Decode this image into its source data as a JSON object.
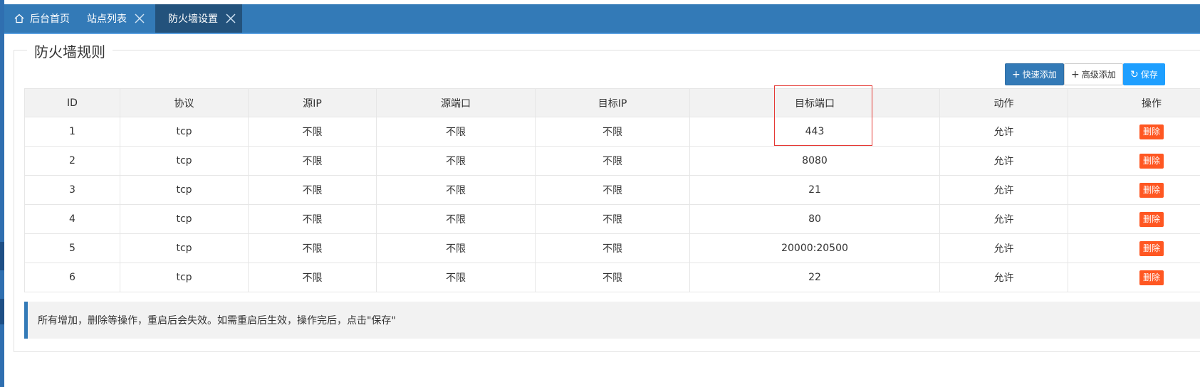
{
  "tabs": [
    {
      "label": "后台首页",
      "icon": "home-icon",
      "closable": false,
      "active": false
    },
    {
      "label": "站点列表",
      "icon": null,
      "closable": true,
      "active": false
    },
    {
      "label": "防火墙设置",
      "icon": null,
      "closable": true,
      "active": true
    }
  ],
  "panel": {
    "title": "防火墙规则"
  },
  "toolbar": {
    "quick_add": "快速添加",
    "advanced_add": "高级添加",
    "save": "保存"
  },
  "table": {
    "columns": [
      "ID",
      "协议",
      "源IP",
      "源端口",
      "目标IP",
      "目标端口",
      "动作",
      "操作"
    ],
    "rows": [
      {
        "id": "1",
        "protocol": "tcp",
        "src_ip": "不限",
        "src_port": "不限",
        "dst_ip": "不限",
        "dst_port": "443",
        "action": "允许",
        "op": "删除"
      },
      {
        "id": "2",
        "protocol": "tcp",
        "src_ip": "不限",
        "src_port": "不限",
        "dst_ip": "不限",
        "dst_port": "8080",
        "action": "允许",
        "op": "删除"
      },
      {
        "id": "3",
        "protocol": "tcp",
        "src_ip": "不限",
        "src_port": "不限",
        "dst_ip": "不限",
        "dst_port": "21",
        "action": "允许",
        "op": "删除"
      },
      {
        "id": "4",
        "protocol": "tcp",
        "src_ip": "不限",
        "src_port": "不限",
        "dst_ip": "不限",
        "dst_port": "80",
        "action": "允许",
        "op": "删除"
      },
      {
        "id": "5",
        "protocol": "tcp",
        "src_ip": "不限",
        "src_port": "不限",
        "dst_ip": "不限",
        "dst_port": "20000:20500",
        "action": "允许",
        "op": "删除"
      },
      {
        "id": "6",
        "protocol": "tcp",
        "src_ip": "不限",
        "src_port": "不限",
        "dst_ip": "不限",
        "dst_port": "22",
        "action": "允许",
        "op": "删除"
      }
    ]
  },
  "notice": "所有增加，删除等操作，重启后会失效。如需重启后生效，操作完后，点击\"保存\"",
  "colors": {
    "nav": "#337ab7",
    "active_tab": "#23527c",
    "delete": "#ff5722",
    "highlight": "#e53935"
  }
}
